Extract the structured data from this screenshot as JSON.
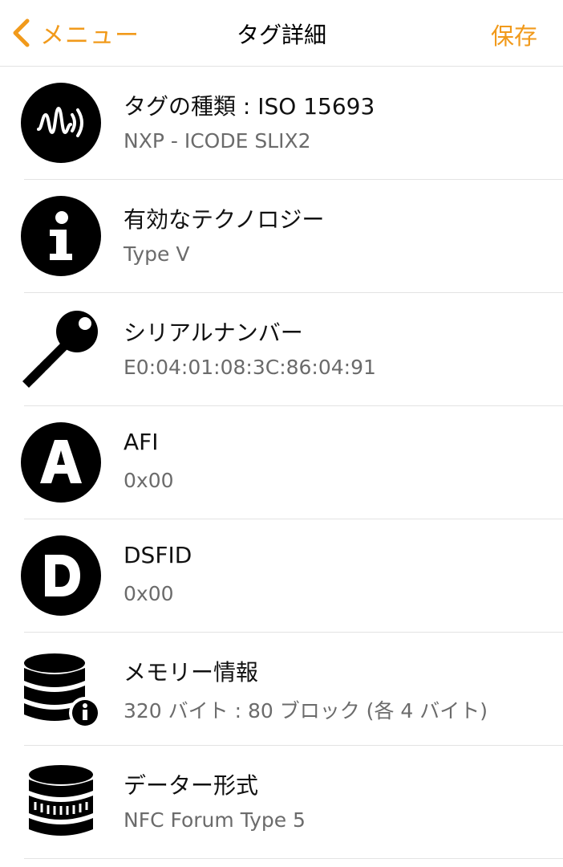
{
  "nav": {
    "back_label": "メニュー",
    "title": "タグ詳細",
    "save_label": "保存"
  },
  "colors": {
    "accent": "#f19a1b",
    "separator": "#e3e3e3",
    "secondary_text": "#6b6b6b"
  },
  "items": [
    {
      "icon": "nfc-tag-icon",
      "title": "タグの種類 : ISO 15693",
      "value": "NXP - ICODE SLIX2"
    },
    {
      "icon": "info-icon",
      "title": "有効なテクノロジー",
      "value": "Type V"
    },
    {
      "icon": "key-icon",
      "title": "シリアルナンバー",
      "value": "E0:04:01:08:3C:86:04:91"
    },
    {
      "icon": "letter-a-icon",
      "title": "AFI",
      "value": "0x00"
    },
    {
      "icon": "letter-d-icon",
      "title": "DSFID",
      "value": "0x00"
    },
    {
      "icon": "database-info-icon",
      "title": "メモリー情報",
      "value": "320 バイト : 80 ブロック (各 4 バイト)"
    },
    {
      "icon": "database-format-icon",
      "title": "データー形式",
      "value": "NFC Forum Type 5"
    }
  ]
}
